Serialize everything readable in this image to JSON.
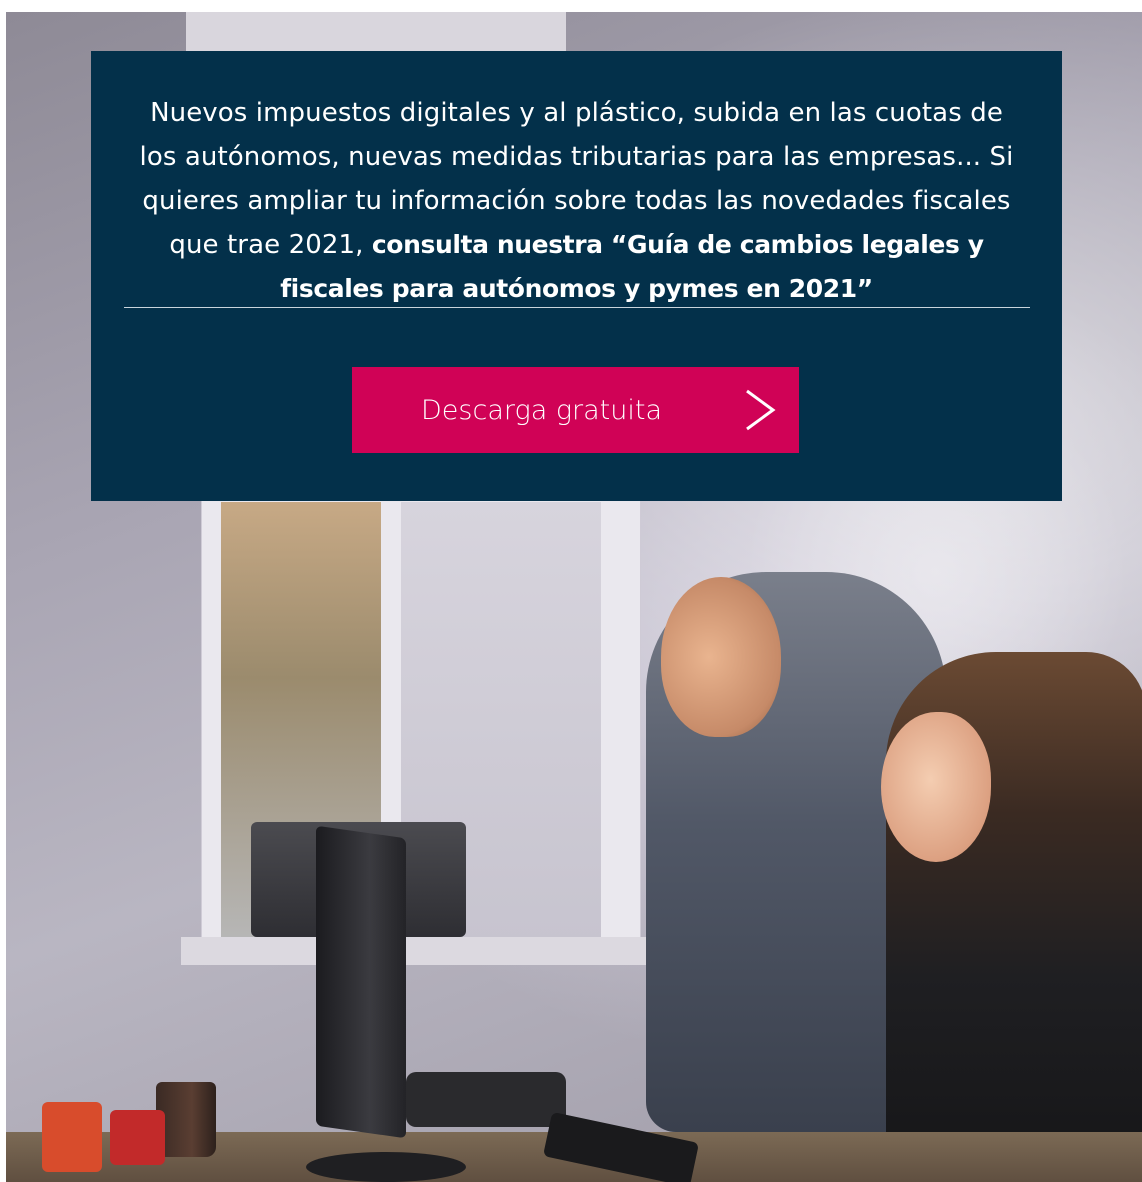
{
  "promo": {
    "text_plain": "Nuevos impuestos digitales y al plástico, subida en las cuotas de los autónomos, nuevas medidas tributarias para las empresas... Si quieres ampliar tu información sobre todas las novedades fiscales que trae 2021, ",
    "text_link": "consulta nuestra “Guía de cambios legales y fiscales para autónomos y pymes en 2021”",
    "button_label": "Descarga gratuita",
    "button_icon": "chevron-right-icon"
  },
  "colors": {
    "card_background": "#03304a",
    "button_background": "#d00256",
    "text": "#ffffff"
  }
}
